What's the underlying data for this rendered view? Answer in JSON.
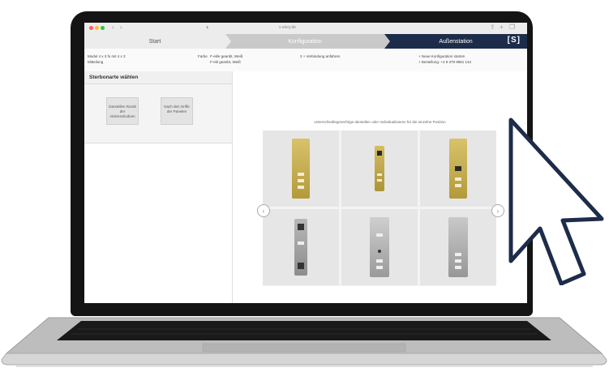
{
  "browser": {
    "url": "s.ekey.de",
    "back_icon": "chevron-left-icon",
    "forward_icon": "chevron-right-icon"
  },
  "steps": [
    "Start",
    "Konfiguration",
    "Außenstation"
  ],
  "brand_logo": "[S]",
  "info": {
    "col1": [
      "Modul 4 x 3 fo mit 4 x 3",
      "Mitteilung"
    ],
    "col2_label": "Farbe",
    "col2": [
      "F-ekle geanbt, Weiß",
      "F-ekl geanbt, Weiß"
    ],
    "col3": "2 + Verbindung anfahren",
    "col4": [
      "+ Neue Konfiguration starten",
      "+ Bestellung: +4 9 379 9981 134"
    ]
  },
  "sidebar": {
    "title": "Sterbonarte wählen",
    "options": [
      "Darstellen Rundt der Aktivendrodnen",
      "Nach den Griffe der Panelen"
    ]
  },
  "main": {
    "instruction": "Unterschiedlegenerfolge darstellen oder Individualisieren für die einzelne Position",
    "tiles": [
      {
        "style": "gold"
      },
      {
        "style": "gold"
      },
      {
        "style": "gold"
      },
      {
        "style": "silver"
      },
      {
        "style": "silver"
      },
      {
        "style": "silver"
      }
    ],
    "prev_icon": "chevron-left-icon",
    "next_icon": "chevron-right-icon"
  },
  "overlay": {
    "cursor_icon": "mouse-pointer-icon",
    "cursor_color": "#1d2c4a"
  }
}
